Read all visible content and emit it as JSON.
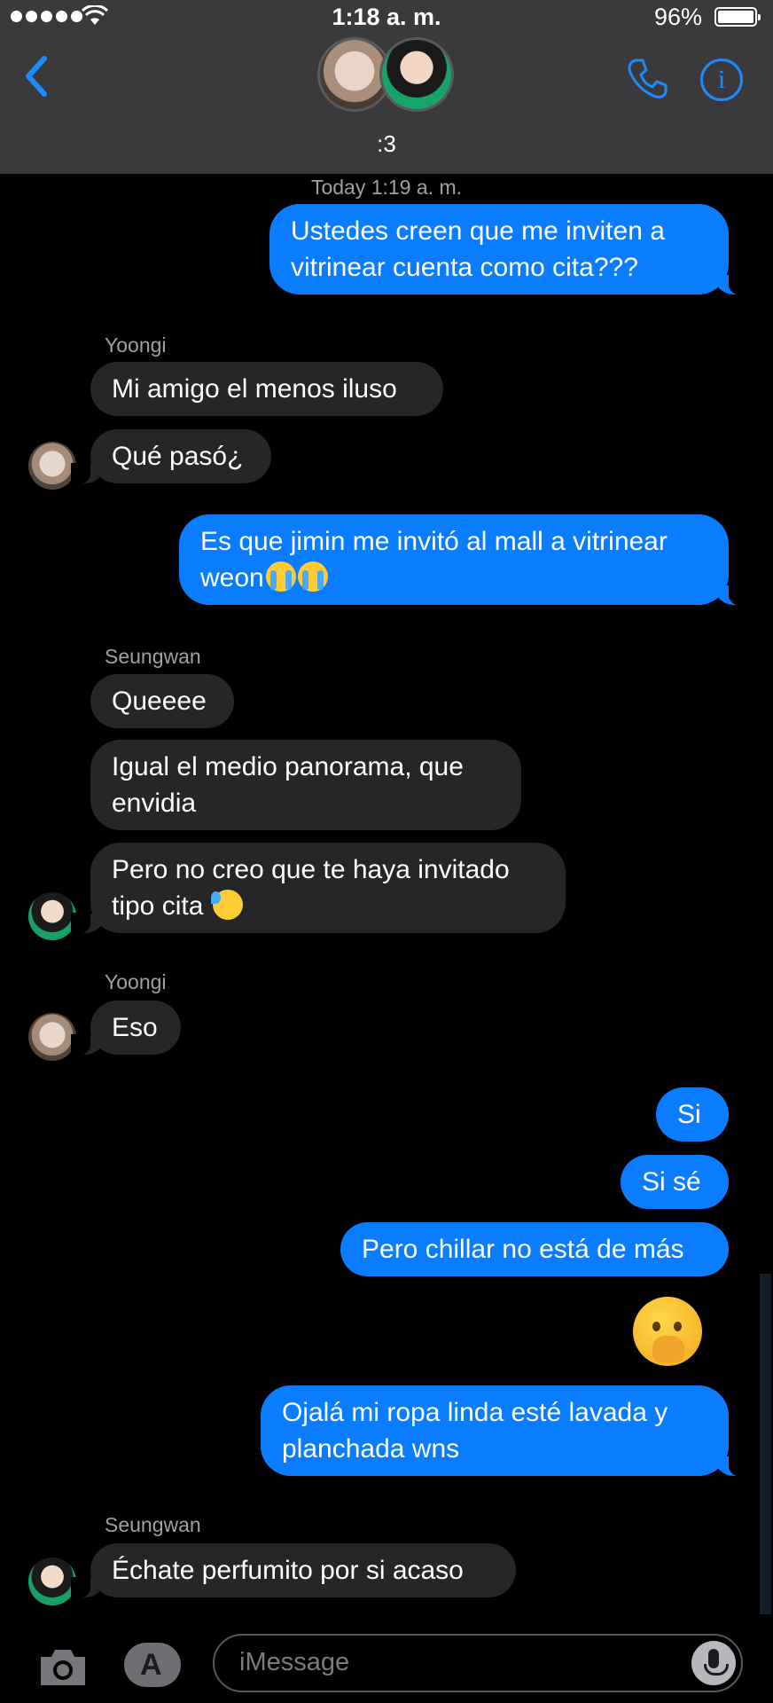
{
  "status_bar": {
    "time": "1:18 a. m.",
    "battery": "96%"
  },
  "conversation": {
    "name": ":3",
    "participants": [
      "Yoongi",
      "Seungwan"
    ]
  },
  "timestamp": "Today 1:19 a. m.",
  "messages": {
    "m1": "Ustedes creen que me inviten a vitrinear cuenta como cita???",
    "s1": "Yoongi",
    "m2": "Mi amigo el menos iluso",
    "m3": "Qué pasó¿",
    "m4": "Es que jimin me invitó al mall a vitrinear weon",
    "s2": "Seungwan",
    "m5": "Queeee",
    "m6": "Igual el medio panorama, que envidia",
    "m7": "Pero no creo que te haya invitado tipo cita",
    "s3": "Yoongi",
    "m8": "Eso",
    "m9": "Si",
    "m10": "Si sé",
    "m11": "Pero chillar no está de más",
    "m12_emoji": "hand-over-mouth-emoji",
    "m13": "Ojalá mi ropa linda esté lavada y planchada wns",
    "s4": "Seungwan",
    "m14": "Échate perfumito por si acaso"
  },
  "composer": {
    "placeholder": "iMessage"
  },
  "colors": {
    "outgoing": "#0a7cff",
    "incoming": "#262628",
    "accent": "#1a8cff"
  }
}
